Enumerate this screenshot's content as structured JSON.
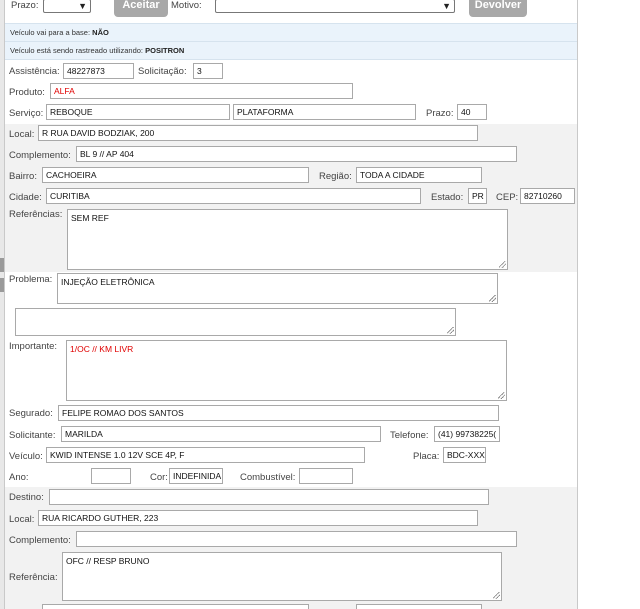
{
  "top": {
    "prazo_label": "Prazo:",
    "aceitar_label": "Aceitar",
    "motivo_label": "Motivo:",
    "devolver_label": "Devolver"
  },
  "info": {
    "base_text": "Veículo vai para a base:",
    "base_value": "NÃO",
    "rastreio_text": "Veículo está sendo rastreado utilizando:",
    "rastreio_value": "POSITRON"
  },
  "form": {
    "assistencia_label": "Assistência:",
    "assistencia": "48227873",
    "solicitacao_label": "Solicitação:",
    "solicitacao": "3",
    "produto_label": "Produto:",
    "produto": "ALFA",
    "servico_label": "Serviço:",
    "servico": "REBOQUE",
    "servico_tipo": "PLATAFORMA",
    "prazo_label": "Prazo:",
    "prazo": "40",
    "local_label": "Local:",
    "local": "R RUA DAVID BODZIAK, 200",
    "complemento_label": "Complemento:",
    "complemento": "BL 9  // AP 404",
    "bairro_label": "Bairro:",
    "bairro": "CACHOEIRA",
    "regiao_label": "Região:",
    "regiao": "TODA A CIDADE",
    "cidade_label": "Cidade:",
    "cidade": "CURITIBA",
    "estado_label": "Estado:",
    "estado": "PR",
    "cep_label": "CEP:",
    "cep": "82710260",
    "referencias_label": "Referências:",
    "referencias": "SEM REF",
    "problema_label": "Problema:",
    "problema": "INJEÇÃO ELETRÔNICA",
    "problema_extra": "",
    "importante_label": "Importante:",
    "importante": "1/OC // KM LIVR",
    "segurado_label": "Segurado:",
    "segurado": "FELIPE ROMAO DOS SANTOS",
    "solicitante_label": "Solicitante:",
    "solicitante": "MARILDA",
    "telefone_label": "Telefone:",
    "telefone": "(41) 99738225(",
    "veiculo_label": "Veículo:",
    "veiculo": "KWID INTENSE 1.0 12V SCE 4P, F",
    "placa_label": "Placa:",
    "placa": "BDC-XXX0",
    "ano_label": "Ano:",
    "ano": "",
    "cor_label": "Cor:",
    "cor": "INDEFINIDA",
    "combustivel_label": "Combustível:",
    "combustivel": ""
  },
  "destino": {
    "destino_label": "Destino:",
    "destino": "",
    "local_label": "Local:",
    "local": "RUA RICARDO GUTHER, 223",
    "complemento_label": "Complemento:",
    "complemento": "",
    "referencia_label": "Referência:",
    "referencia": "OFC // RESP BRUNO"
  }
}
